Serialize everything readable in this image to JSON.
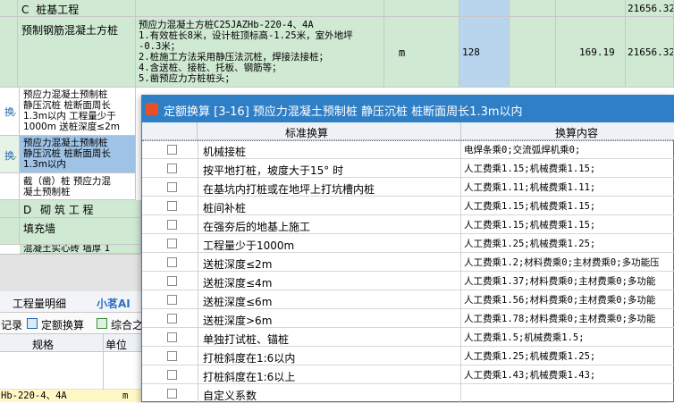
{
  "top_rows": [
    {
      "code": "C",
      "name": "桩基工程",
      "total": "21656.32"
    },
    {
      "name": "预制钢筋混凝土方桩",
      "desc_lines": [
        "预应力混凝土方桩C25JAZHb-220-4、4A",
        "1.有效桩长8米，设计桩顶标高-1.25米，室外地坪",
        "-0.3米；",
        "2.桩施工方法采用静压法沉桩，焊接法接桩；",
        "4.含送桩、接桩、托板、钢筋等；",
        "5.凿预应力方桩桩头；"
      ],
      "unit": "m",
      "qty": "128",
      "price": "169.19",
      "total": "21656.32"
    }
  ],
  "quota_rows": [
    {
      "icon": "换",
      "lines": [
        "预应力混凝土预制桩",
        "静压沉桩 桩断面周长",
        "1.3m以内 工程量少于",
        "1000m 送桩深度≤2m"
      ]
    },
    {
      "icon": "换",
      "lines": [
        "预应力混凝土预制桩",
        "静压沉桩 桩断面周长",
        "1.3m以内"
      ]
    },
    {
      "icon": "",
      "lines": [
        "截（凿）桩 预应力混",
        "凝土预制桩"
      ]
    }
  ],
  "section_d": {
    "code": "D",
    "name": "砌 筑 工 程"
  },
  "fill_row": {
    "name": "填充墙"
  },
  "partial_row": "混凝土实心砖 墙厚 1",
  "bottom_tabs": [
    "工程量明细",
    "小茗AI"
  ],
  "toolbar_items": [
    "记录",
    "定额换算",
    "综合之"
  ],
  "bottom_headers": {
    "spec": "规格",
    "unit": "单位"
  },
  "bottom_row": {
    "spec": "Hb-220-4、4A",
    "unit": "m"
  },
  "dialog": {
    "title": "定额换算 [3-16] 预应力混凝土预制桩 静压沉桩 桩断面周长1.3m以内",
    "col_standard": "标准换算",
    "col_content": "换算内容",
    "rows": [
      {
        "name": "机械接桩",
        "content": "电焊条乘0;交流弧焊机乘0;"
      },
      {
        "name": "按平地打桩，坡度大于15° 时",
        "content": "人工费乘1.15;机械费乘1.15;"
      },
      {
        "name": "在基坑内打桩或在地坪上打坑槽内桩",
        "content": "人工费乘1.11;机械费乘1.11;"
      },
      {
        "name": "桩间补桩",
        "content": "人工费乘1.15;机械费乘1.15;"
      },
      {
        "name": "在强夯后的地基上施工",
        "content": "人工费乘1.15;机械费乘1.15;"
      },
      {
        "name": "工程量少于1000m",
        "content": "人工费乘1.25;机械费乘1.25;"
      },
      {
        "name": "送桩深度≤2m",
        "content": "人工费乘1.2;材料费乘0;主材费乘0;多功能压"
      },
      {
        "name": "送桩深度≤4m",
        "content": "人工费乘1.37;材料费乘0;主材费乘0;多功能"
      },
      {
        "name": "送桩深度≤6m",
        "content": "人工费乘1.56;材料费乘0;主材费乘0;多功能"
      },
      {
        "name": "送桩深度>6m",
        "content": "人工费乘1.78;材料费乘0;主材费乘0;多功能"
      },
      {
        "name": "单独打试桩、锚桩",
        "content": "人工费乘1.5;机械费乘1.5;"
      },
      {
        "name": "打桩斜度在1:6以内",
        "content": "人工费乘1.25;机械费乘1.25;"
      },
      {
        "name": "打桩斜度在1:6以上",
        "content": "人工费乘1.43;机械费乘1.43;"
      },
      {
        "name": "自定义系数",
        "content": ""
      }
    ]
  }
}
